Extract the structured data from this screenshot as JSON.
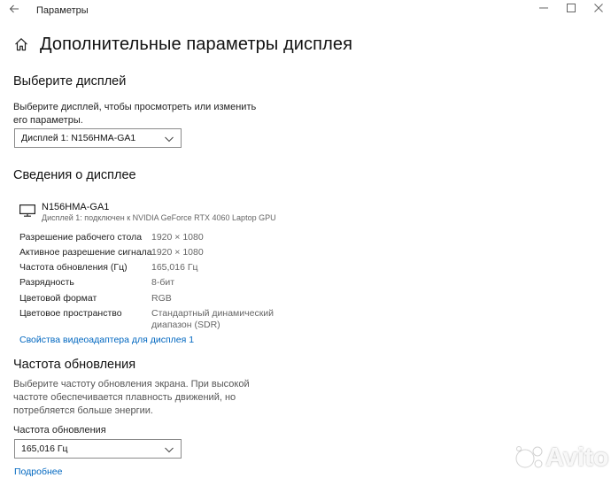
{
  "window": {
    "title": "Параметры",
    "back_icon": "arrow-left-icon",
    "min_icon": "minimize-icon",
    "max_icon": "maximize-icon",
    "close_icon": "close-icon"
  },
  "header": {
    "title": "Дополнительные параметры дисплея",
    "icon": "home-icon"
  },
  "select_display": {
    "heading": "Выберите дисплей",
    "description": "Выберите дисплей, чтобы просмотреть или изменить его параметры.",
    "value": "Дисплей 1: N156HMA-GA1"
  },
  "display_info": {
    "heading": "Сведения о дисплее",
    "monitor_name": "N156HMA-GA1",
    "monitor_subtitle": "Дисплей 1: подключен к NVIDIA GeForce RTX 4060 Laptop GPU",
    "rows": [
      {
        "label": "Разрешение рабочего стола",
        "value": "1920 × 1080"
      },
      {
        "label": "Активное разрешение сигнала",
        "value": "1920 × 1080"
      },
      {
        "label": "Частота обновления (Гц)",
        "value": "165,016 Гц"
      },
      {
        "label": "Разрядность",
        "value": "8-бит"
      },
      {
        "label": "Цветовой формат",
        "value": "RGB"
      },
      {
        "label": "Цветовое пространство",
        "value": "Стандартный динамический диапазон (SDR)"
      }
    ],
    "adapter_link": "Свойства видеоадаптера для дисплея 1"
  },
  "refresh": {
    "heading": "Частота обновления",
    "description": "Выберите частоту обновления экрана. При высокой частоте обеспечивается плавность движений, но потребляется больше энергии.",
    "field_label": "Частота обновления",
    "value": "165,016 Гц",
    "more_link": "Подробнее"
  },
  "watermark": {
    "text": "Avito"
  },
  "colors": {
    "link": "#0067c0",
    "muted": "#666666"
  }
}
